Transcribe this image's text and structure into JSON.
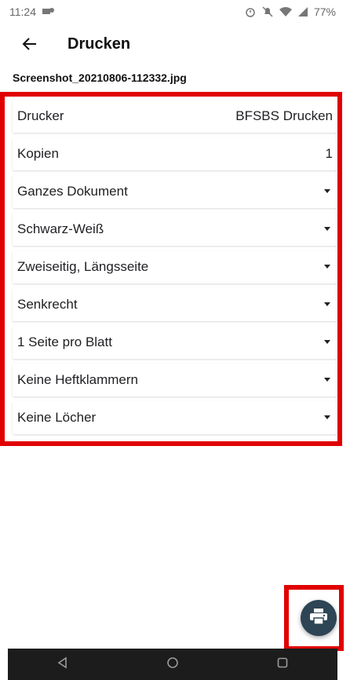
{
  "statusbar": {
    "time": "11:24",
    "battery": "77%",
    "icons": [
      "alarm-icon",
      "mute-icon",
      "wifi-icon",
      "signal-icon"
    ]
  },
  "appbar": {
    "title": "Drucken"
  },
  "file": {
    "name": "Screenshot_20210806-112332.jpg"
  },
  "settings": [
    {
      "label": "Drucker",
      "value": "BFSBS Drucken"
    },
    {
      "label": "Kopien",
      "value": "1"
    },
    {
      "label": "Ganzes Dokument"
    },
    {
      "label": "Schwarz-Weiß"
    },
    {
      "label": "Zweiseitig, Längsseite"
    },
    {
      "label": "Senkrecht"
    },
    {
      "label": "1 Seite pro Blatt"
    },
    {
      "label": "Keine Heftklammern"
    },
    {
      "label": "Keine Löcher"
    }
  ],
  "colors": {
    "fab": "#2d4554",
    "highlight": "#e00000",
    "navbar": "#1c1c1c"
  }
}
